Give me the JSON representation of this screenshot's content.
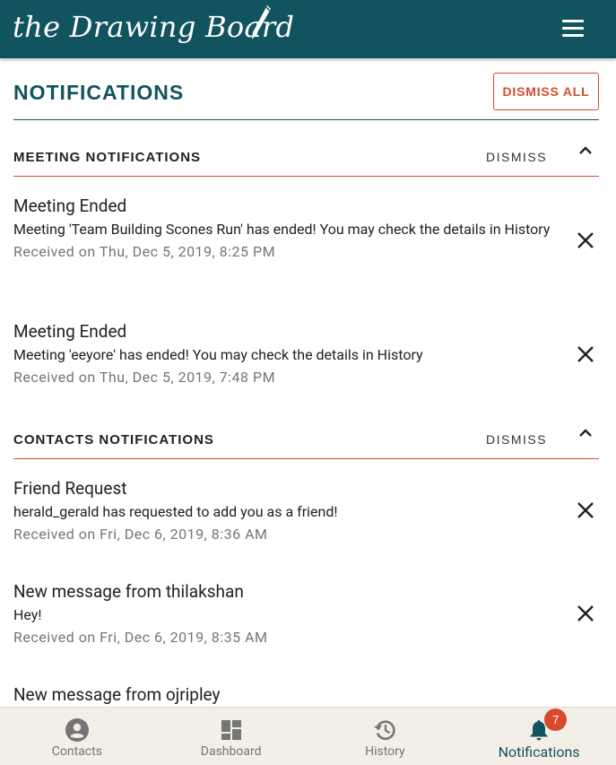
{
  "app": {
    "logo_text": "the Drawing Board"
  },
  "page": {
    "title": "NOTIFICATIONS",
    "dismiss_all_label": "DISMISS ALL"
  },
  "sections": [
    {
      "title": "MEETING NOTIFICATIONS",
      "dismiss_label": "DISMISS",
      "items": [
        {
          "title": "Meeting Ended",
          "body": "Meeting 'Team Building Scones Run' has ended! You may check the details in History",
          "time": "Received on Thu, Dec 5, 2019, 8:25 PM"
        },
        {
          "title": "Meeting Ended",
          "body": "Meeting 'eeyore' has ended! You may check the details in History",
          "time": "Received on Thu, Dec 5, 2019, 7:48 PM"
        }
      ]
    },
    {
      "title": "CONTACTS NOTIFICATIONS",
      "dismiss_label": "DISMISS",
      "items": [
        {
          "title": "Friend Request",
          "body": "herald_gerald has requested to add you as a friend!",
          "time": "Received on Fri, Dec 6, 2019, 8:36 AM"
        },
        {
          "title": "New message from thilakshan",
          "body": "Hey!",
          "time": "Received on Fri, Dec 6, 2019, 8:35 AM"
        },
        {
          "title": "New message from ojripley"
        }
      ]
    }
  ],
  "bottom_nav": [
    {
      "label": "Contacts",
      "icon": "account-circle-icon"
    },
    {
      "label": "Dashboard",
      "icon": "dashboard-icon"
    },
    {
      "label": "History",
      "icon": "history-icon"
    },
    {
      "label": "Notifications",
      "icon": "bell-icon",
      "badge": "7",
      "active": true
    }
  ],
  "colors": {
    "primary": "#11535f",
    "accent": "#d84a2b",
    "nav_bg": "#f4efe6"
  }
}
